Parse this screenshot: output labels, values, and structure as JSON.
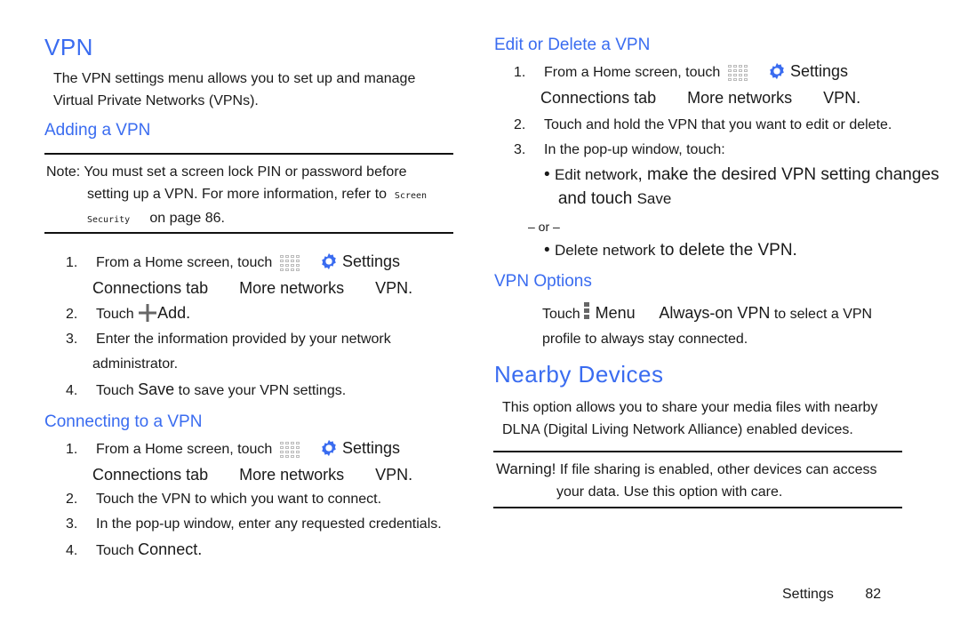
{
  "vpn": {
    "title": "VPN",
    "intro_1": "The VPN settings menu allows you to set up and manage",
    "intro_2": "Virtual Private Networks (VPNs).",
    "adding": {
      "title": "Adding a VPN",
      "note_label": "Note:",
      "note_1": "You must set a screen lock PIN or password before",
      "note_2": "setting up a VPN. For more information, refer to",
      "note_link_1": "Screen",
      "note_link_2": "Security",
      "note_3": "on page 86.",
      "steps": [
        {
          "num": "1.",
          "a": "From a Home screen, touch",
          "b": "Settings",
          "c": "Connections tab",
          "d": "More networks",
          "e": "VPN."
        },
        {
          "num": "2.",
          "a": "Touch",
          "b": "Add."
        },
        {
          "num": "3.",
          "a": "Enter the information provided by your network",
          "b": "administrator."
        },
        {
          "num": "4.",
          "a": "Touch",
          "b": "Save",
          "c": "to save your VPN settings."
        }
      ]
    },
    "connecting": {
      "title": "Connecting to a VPN",
      "steps": [
        {
          "num": "1.",
          "a": "From a Home screen, touch",
          "b": "Settings",
          "c": "Connections tab",
          "d": "More networks",
          "e": "VPN."
        },
        {
          "num": "2.",
          "a": "Touch the VPN to which you want to connect."
        },
        {
          "num": "3.",
          "a": "In the pop-up window, enter any requested credentials."
        },
        {
          "num": "4.",
          "a": "Touch",
          "b": "Connect."
        }
      ]
    }
  },
  "edit": {
    "title": "Edit or Delete a VPN",
    "steps": [
      {
        "num": "1.",
        "a": "From a Home screen, touch",
        "b": "Settings",
        "c": "Connections tab",
        "d": "More networks",
        "e": "VPN."
      },
      {
        "num": "2.",
        "a": "Touch and hold the VPN that you want to edit or delete."
      },
      {
        "num": "3.",
        "a": "In the pop-up window, touch:"
      }
    ],
    "bullet_1a": "Edit network",
    "bullet_1b": ", make the desired VPN setting changes",
    "bullet_1c": "and touch",
    "bullet_1d": "Save",
    "or": "– or –",
    "bullet_2a": "Delete network",
    "bullet_2b": "to delete the VPN."
  },
  "options": {
    "title": "VPN Options",
    "a": "Touch",
    "b": "Menu",
    "c": "Always-on VPN",
    "d": "to select a VPN",
    "e": "profile to always stay connected."
  },
  "nearby": {
    "title": "Nearby Devices",
    "intro_1": "This option allows you to share your media files with nearby",
    "intro_2": "DLNA (Digital Living Network Alliance) enabled devices.",
    "warning_label": "Warning!",
    "warning_1": "If file sharing is enabled, other devices can access",
    "warning_2": "your data. Use this option with care."
  },
  "footer": {
    "section": "Settings",
    "page": "82"
  },
  "colors": {
    "heading": "#3a6cf0",
    "gear": "#3a6cf0"
  }
}
